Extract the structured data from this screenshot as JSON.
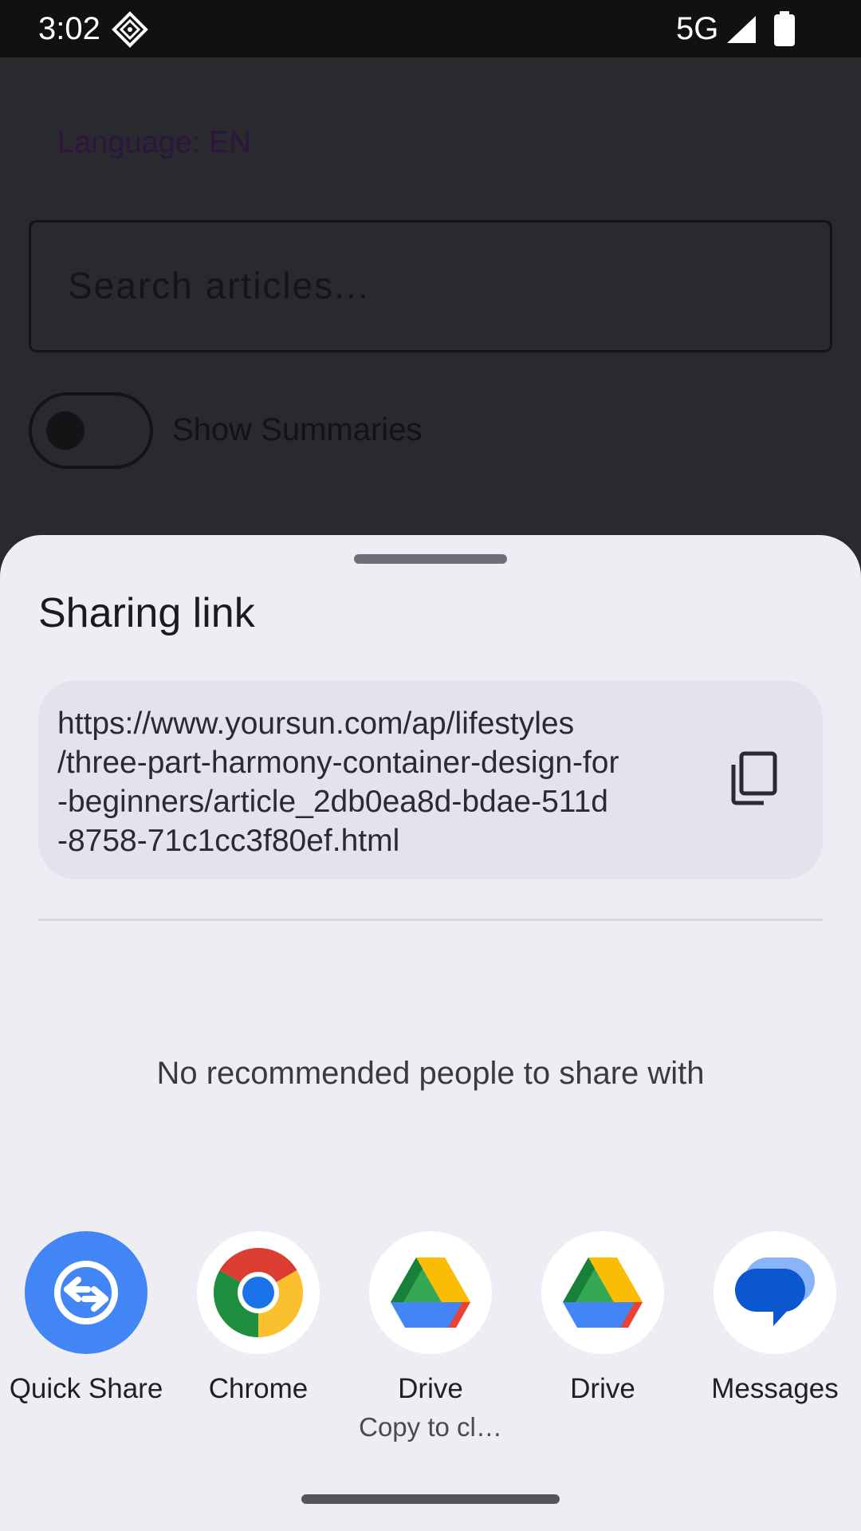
{
  "status_bar": {
    "time": "3:02",
    "network": "5G",
    "icons": [
      "assistant-diamond-icon",
      "signal-icon",
      "battery-icon"
    ]
  },
  "background_app": {
    "language_label": "Language: EN",
    "search_placeholder": "Search articles...",
    "toggle_label": "Show Summaries",
    "toggle_on": false
  },
  "share_sheet": {
    "title": "Sharing link",
    "link_lines": [
      "https://www.yoursun.com/ap/lifestyles",
      "/three-part-harmony-container-design-for",
      "-beginners/article_2db0ea8d-bdae-511d",
      "-8758-71c1cc3f80ef.html"
    ],
    "copy_icon": "copy-icon",
    "no_people_text": "No recommended people to share with",
    "targets": [
      {
        "label": "Quick Share",
        "sublabel": "",
        "icon": "quick-share-icon"
      },
      {
        "label": "Chrome",
        "sublabel": "",
        "icon": "chrome-icon"
      },
      {
        "label": "Drive",
        "sublabel": "Copy to cl…",
        "icon": "drive-icon"
      },
      {
        "label": "Drive",
        "sublabel": "",
        "icon": "drive-icon"
      },
      {
        "label": "Messages",
        "sublabel": "",
        "icon": "messages-icon"
      }
    ]
  },
  "colors": {
    "sheet_bg": "#eeedf4",
    "link_card_bg": "#e4e2ec",
    "quick_share_blue": "#4285f4",
    "scrim": "#2a2a2e"
  }
}
